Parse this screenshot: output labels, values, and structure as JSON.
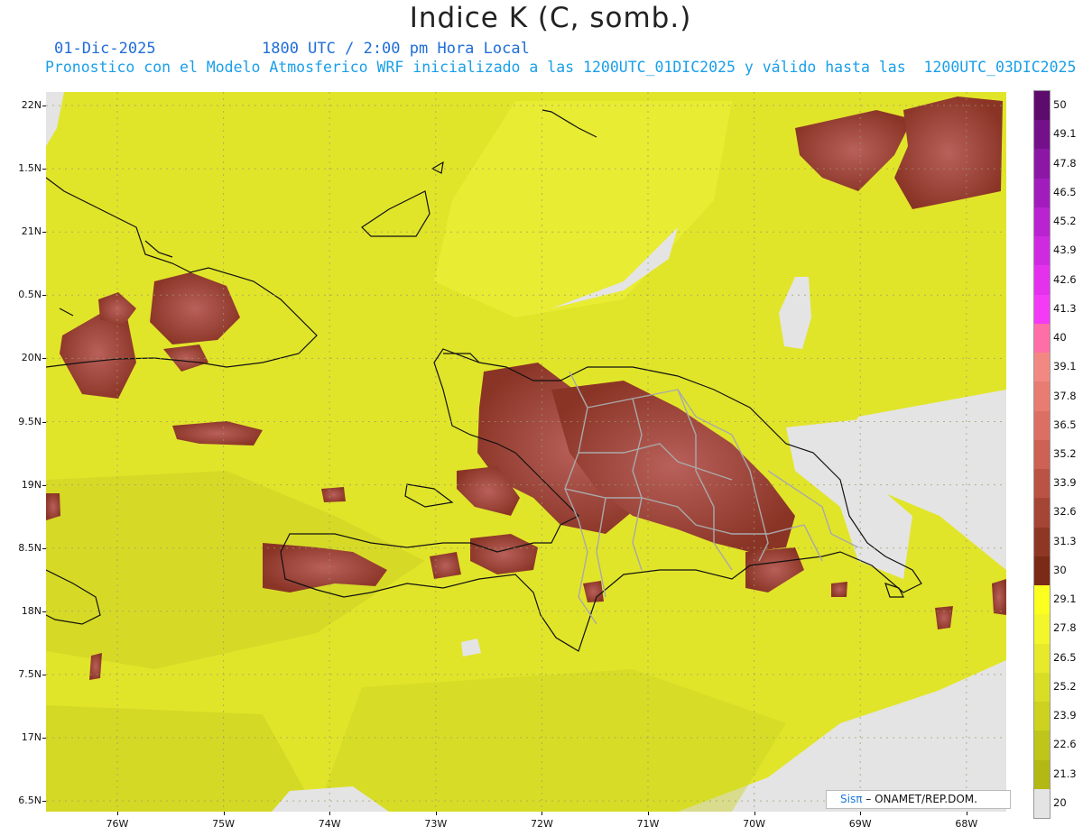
{
  "header": {
    "title": "Indice K (C, somb.)",
    "date": "01-Dic-2025",
    "valid_time": "1800 UTC / 2:00 pm Hora Local",
    "description": "Pronostico con el Modelo Atmosferico WRF inicializado a las 1200UTC_01DIC2025 y válido hasta las  1200UTC_03DIC2025"
  },
  "map": {
    "lat_labels": [
      "22N",
      "1.5N",
      "21N",
      "0.5N",
      "20N",
      "9.5N",
      "19N",
      "8.5N",
      "18N",
      "7.5N",
      "17N",
      "6.5N"
    ],
    "lon_labels": [
      "76W",
      "75W",
      "74W",
      "73W",
      "72W",
      "71W",
      "70W",
      "69W",
      "68W"
    ],
    "colors": {
      "no_data": "#e4e4e4",
      "base_field": "#e2e629",
      "high_k": "#8f3a2a",
      "boundary": "#111111",
      "provinces": "#a9a9a9"
    }
  },
  "colorbar": {
    "labels": [
      "50",
      "49.1",
      "47.8",
      "46.5",
      "45.2",
      "43.9",
      "42.6",
      "41.3",
      "40",
      "39.1",
      "37.8",
      "36.5",
      "35.2",
      "33.9",
      "32.6",
      "31.3",
      "30",
      "29.1",
      "27.8",
      "26.5",
      "25.2",
      "23.9",
      "22.6",
      "21.3",
      "20"
    ],
    "colors": [
      "#5e0b6e",
      "#74118a",
      "#8c17a5",
      "#a21cbd",
      "#b923d0",
      "#cf2ae0",
      "#e431ee",
      "#f33bf7",
      "#ff6ea6",
      "#f38882",
      "#e87c72",
      "#dc6f63",
      "#cc6154",
      "#ba5344",
      "#a54535",
      "#8e3725",
      "#7a2a17",
      "#fbff1f",
      "#f2f62a",
      "#e6ea2b",
      "#d9de25",
      "#ccd21f",
      "#c0c619",
      "#b3b814",
      "#e4e4e4"
    ]
  },
  "credit": {
    "sis": "Sisπ",
    "org": " – ONAMET/REP.DOM."
  }
}
